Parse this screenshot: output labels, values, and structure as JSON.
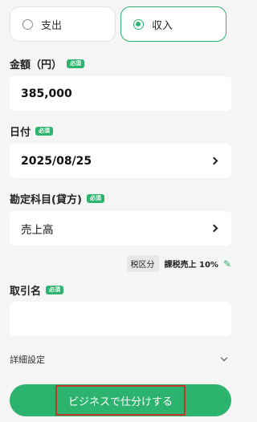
{
  "type_toggle": {
    "expense_label": "支出",
    "income_label": "収入"
  },
  "amount": {
    "label": "金額（円）",
    "required": "必須",
    "value": "385,000"
  },
  "date": {
    "label": "日付",
    "required": "必須",
    "value": "2025/08/25"
  },
  "account": {
    "label": "勘定科目(貸方)",
    "required": "必須",
    "value": "売上高"
  },
  "tax": {
    "chip": "税区分",
    "value": "課税売上 10%"
  },
  "partner": {
    "label": "取引名",
    "required": "必須",
    "value": ""
  },
  "details": {
    "label": "詳細設定"
  },
  "submit": {
    "label": "ビジネスで仕分けする"
  },
  "colors": {
    "accent": "#2cb36e",
    "highlight_box": "#c0392b"
  }
}
